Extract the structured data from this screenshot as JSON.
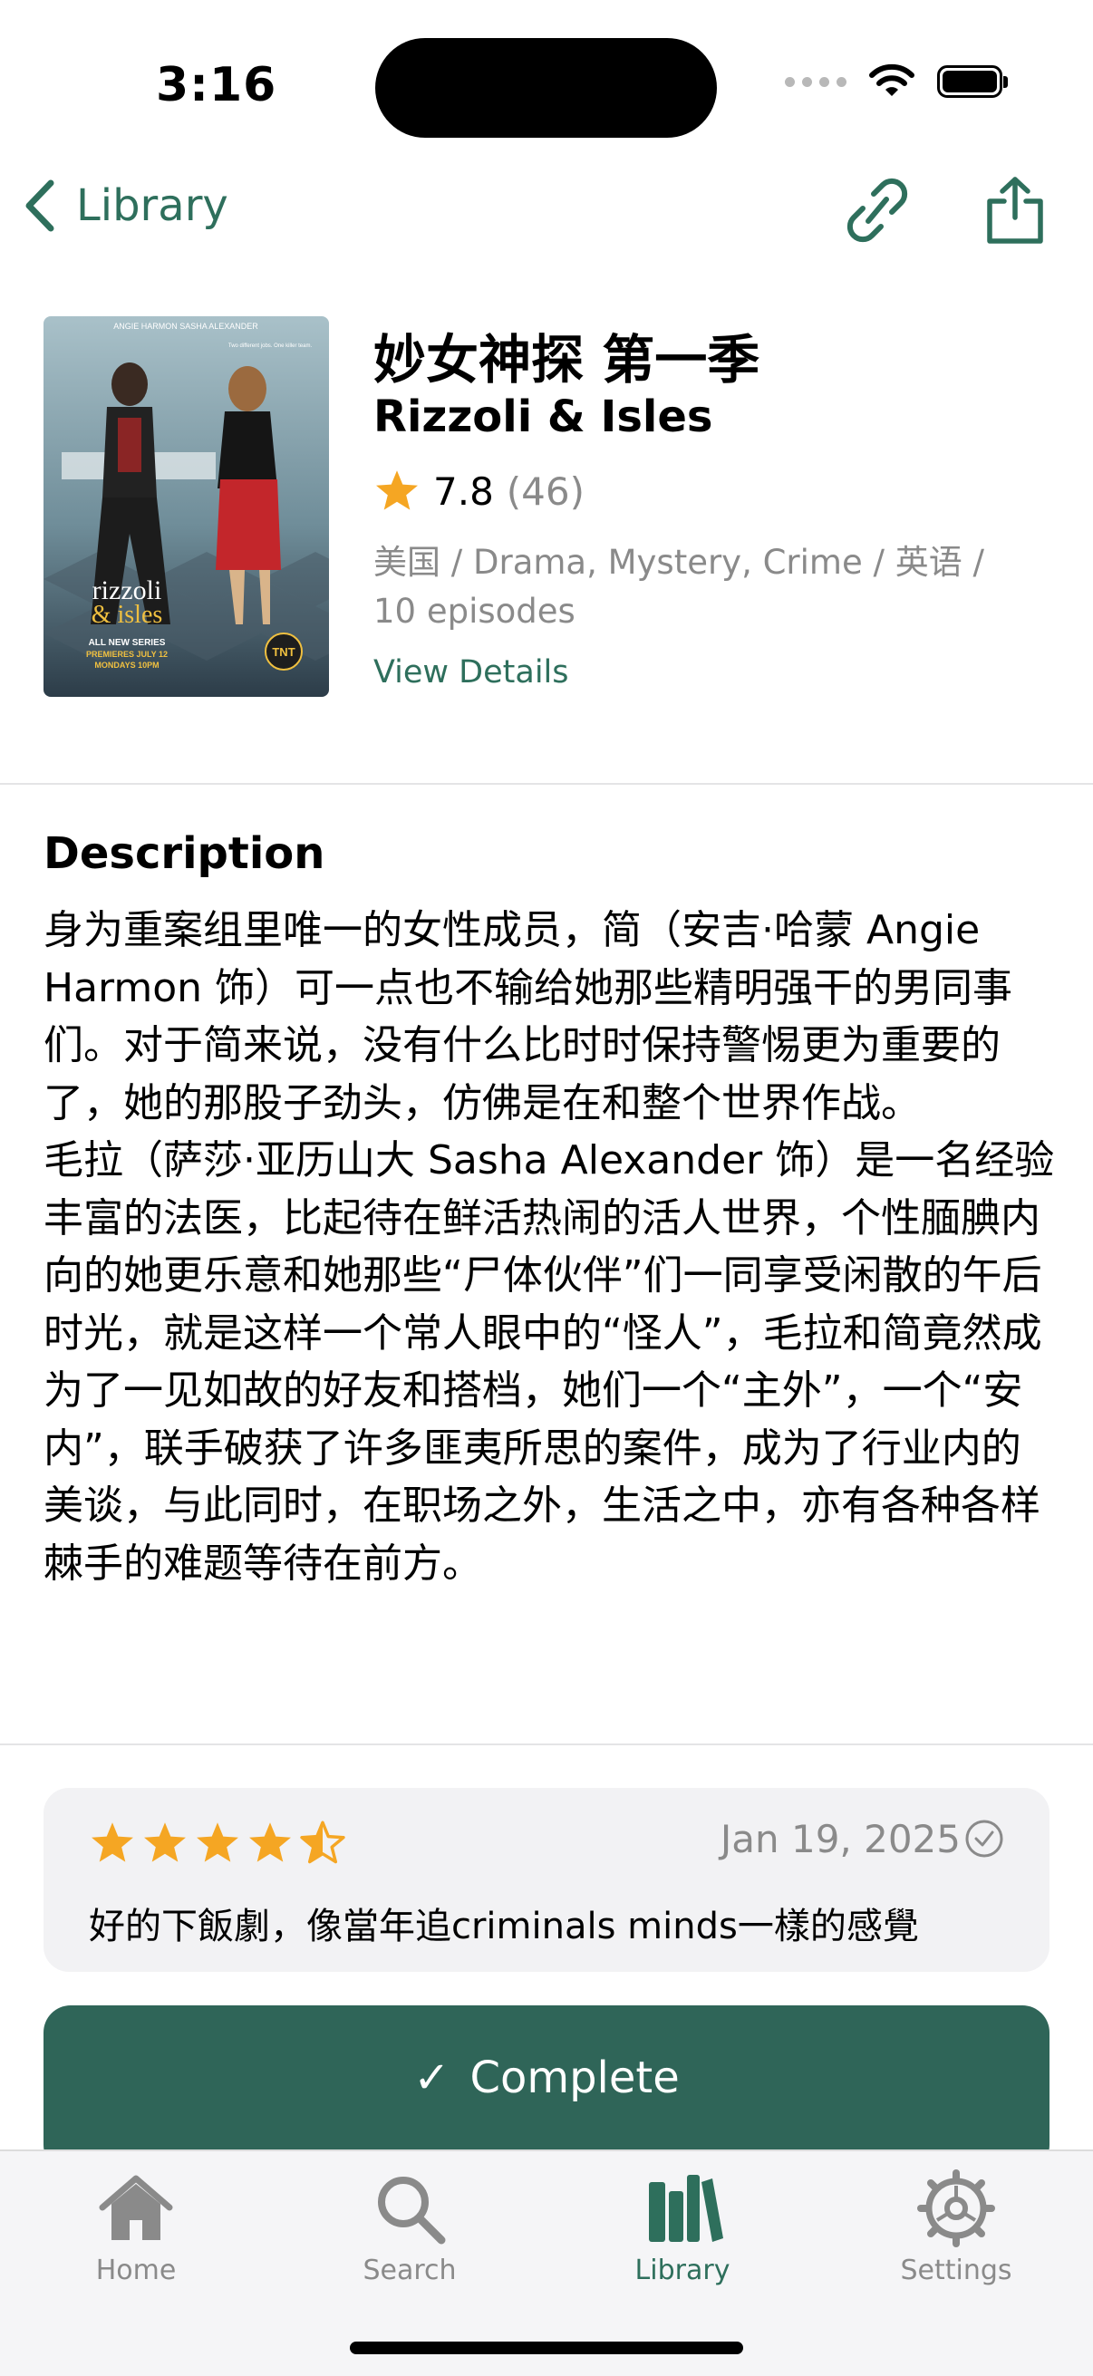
{
  "status_bar": {
    "time": "3:16"
  },
  "nav": {
    "back_label": "Library",
    "link_icon": "link-icon",
    "share_icon": "share-icon"
  },
  "show": {
    "title_zh": "妙女神探 第一季",
    "title_en": "Rizzoli & Isles",
    "rating": "7.8",
    "rating_count": "(46)",
    "meta": "美国 / Drama, Mystery, Crime / 英语 / 10 episodes",
    "view_details": "View Details",
    "poster": {
      "actors": "ANGIE HARMON     SASHA ALEXANDER",
      "tagline": "Two different jobs. One killer team.",
      "logo_line1": "rizzoli",
      "logo_line2": "& isles",
      "promo1": "ALL NEW SERIES",
      "promo2": "PREMIERES JULY 12",
      "promo3": "MONDAYS 10PM",
      "network": "TNT"
    }
  },
  "description": {
    "heading": "Description",
    "body": "身为重案组里唯一的女性成员，简（安吉·哈蒙 Angie Harmon 饰）可一点也不输给她那些精明强干的男同事们。对于简来说，没有什么比时时保持警惕更为重要的了，她的那股子劲头，仿佛是在和整个世界作战。\n毛拉（萨莎·亚历山大 Sasha Alexander 饰）是一名经验丰富的法医，比起待在鲜活热闹的活人世界，个性腼腆内向的她更乐意和她那些“尸体伙伴”们一同享受闲散的午后时光，就是这样一个常人眼中的“怪人”，毛拉和简竟然成为了一见如故的好友和搭档，她们一个“主外”，一个“安内”，联手破获了许多匪夷所思的案件，成为了行业内的美谈，与此同时，在职场之外，生活之中，亦有各种各样棘手的难题等待在前方。"
  },
  "review": {
    "stars": 4.5,
    "max_stars": 5,
    "date": "Jan 19, 2025",
    "text": "好的下飯劇，像當年追criminals minds一樣的感覺"
  },
  "complete_button": {
    "check": "✓",
    "label": "Complete"
  },
  "tab_bar": {
    "items": [
      {
        "label": "Home",
        "icon": "house-icon",
        "active": false
      },
      {
        "label": "Search",
        "icon": "magnifier-icon",
        "active": false
      },
      {
        "label": "Library",
        "icon": "books-icon",
        "active": true
      },
      {
        "label": "Settings",
        "icon": "gear-icon",
        "active": false
      }
    ]
  },
  "colors": {
    "accent": "#2e6f5c",
    "button": "#2f6558",
    "star": "#f5a623",
    "secondary_text": "#8a8a8a"
  }
}
